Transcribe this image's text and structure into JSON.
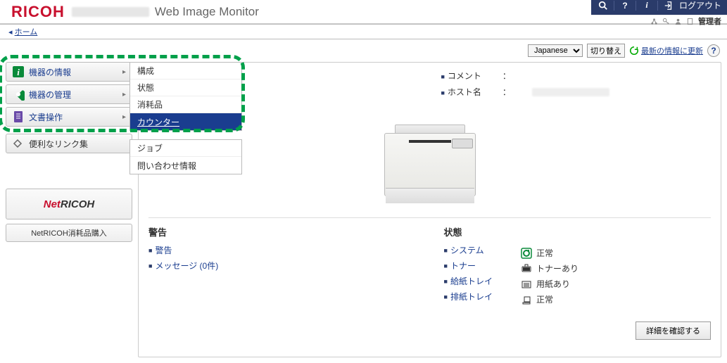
{
  "header": {
    "logo": "RICOH",
    "app_title": "Web Image Monitor",
    "logout_label": "ログアウト",
    "admin_label": "管理者"
  },
  "breadcrumb": {
    "home": "ホーム"
  },
  "toolbar": {
    "language_selected": "Japanese",
    "switch_label": "切り替え",
    "refresh_label": "最新の情報に更新"
  },
  "sidebar": {
    "items": [
      {
        "label": "機器の情報"
      },
      {
        "label": "機器の管理"
      },
      {
        "label": "文書操作"
      },
      {
        "label": "便利なリンク集"
      }
    ],
    "netricoh_logo": "NetRICOH",
    "netricoh_button": "NetRICOH消耗品購入"
  },
  "submenu": [
    {
      "label": "構成"
    },
    {
      "label": "状態"
    },
    {
      "label": "消耗品"
    },
    {
      "label": "カウンター",
      "active": true
    }
  ],
  "submenu2": [
    {
      "label": "ジョブ"
    },
    {
      "label": "問い合わせ情報"
    }
  ],
  "content": {
    "kv": [
      {
        "key": "コメント",
        "colon": "："
      },
      {
        "key": "ホスト名",
        "colon": "："
      }
    ],
    "warning_heading": "警告",
    "warning_items": [
      {
        "label": "警告"
      },
      {
        "label": "メッセージ (0件)"
      }
    ],
    "status_heading": "状態",
    "status_items": [
      {
        "label": "システム",
        "value": "正常",
        "icon": "normal"
      },
      {
        "label": "トナー",
        "value": "トナーあり",
        "icon": "toner"
      },
      {
        "label": "給紙トレイ",
        "value": "用紙あり",
        "icon": "paper"
      },
      {
        "label": "排紙トレイ",
        "value": "正常",
        "icon": "output"
      }
    ],
    "detail_button": "詳細を確認する"
  }
}
